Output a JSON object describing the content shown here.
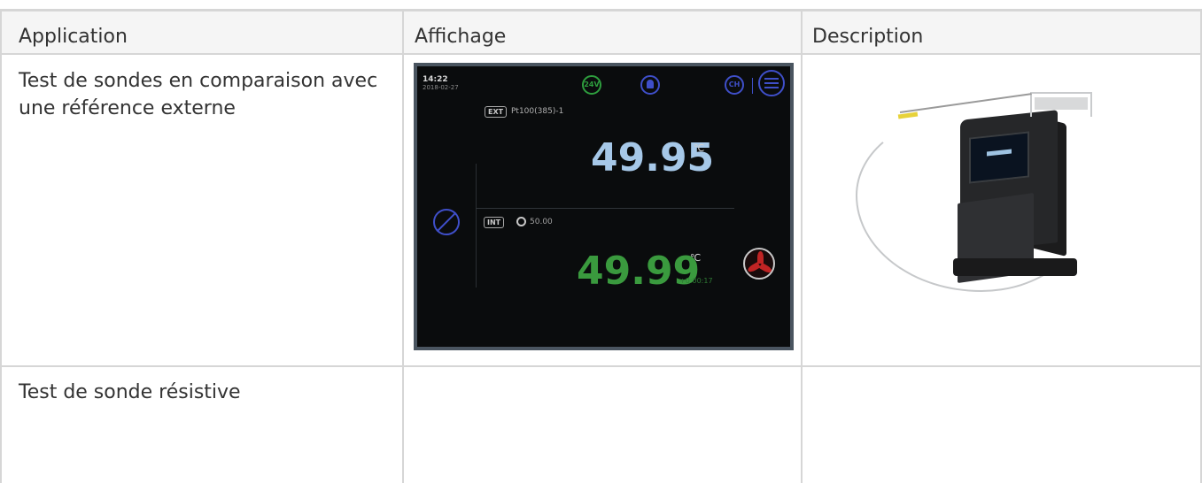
{
  "table": {
    "headers": [
      "Application",
      "Affichage",
      "Description"
    ],
    "rows": [
      {
        "application": "Test de sondes en comparaison avec une référence externe"
      },
      {
        "application": "Test de sonde résistive"
      }
    ]
  },
  "display_screen": {
    "time": "14:22",
    "date": "2018-02-27",
    "status_24v": "24V",
    "status_ch": "CH",
    "ext_tag": "EXT",
    "ext_probe": "Pt100(385)-1",
    "ext_value": "49.95",
    "ext_unit": "℃",
    "int_tag": "INT",
    "setpoint": "50.00",
    "int_value": "49.99",
    "int_unit": "℃",
    "timer": "+0:00:17",
    "colors": {
      "ext_value": "#a6c8e8",
      "int_value": "#3a9a3e",
      "icons": "#3f4fc9",
      "fan": "#c02424"
    }
  },
  "icons": [
    "24v-indicator-icon",
    "bell-icon",
    "ch-indicator-icon",
    "menu-icon",
    "no-probe-icon",
    "setpoint-target-icon",
    "fan-icon"
  ]
}
